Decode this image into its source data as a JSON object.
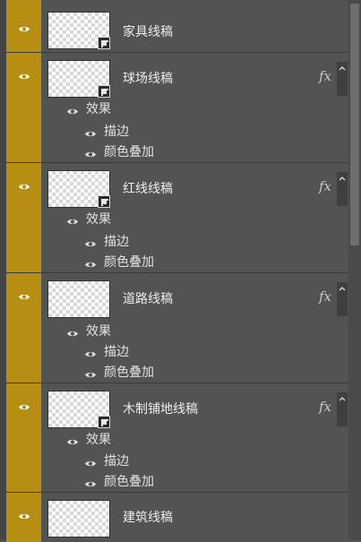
{
  "colors": {
    "visibility_column": "#b58e12",
    "panel_bg": "#535353"
  },
  "layers": [
    {
      "name": "家具线稿",
      "has_fx": false,
      "has_smart_badge": true,
      "effects": null
    },
    {
      "name": "球场线稿",
      "has_fx": true,
      "fx_label": "fx",
      "has_smart_badge": true,
      "effects": {
        "label": "效果",
        "items": [
          "描边",
          "颜色叠加"
        ]
      }
    },
    {
      "name": "红线线稿",
      "has_fx": true,
      "fx_label": "fx",
      "has_smart_badge": true,
      "effects": {
        "label": "效果",
        "items": [
          "描边",
          "颜色叠加"
        ]
      }
    },
    {
      "name": "道路线稿",
      "has_fx": true,
      "fx_label": "fx",
      "has_smart_badge": false,
      "effects": {
        "label": "效果",
        "items": [
          "描边",
          "颜色叠加"
        ]
      }
    },
    {
      "name": "木制铺地线稿",
      "has_fx": true,
      "fx_label": "fx",
      "has_smart_badge": true,
      "effects": {
        "label": "效果",
        "items": [
          "描边",
          "颜色叠加"
        ]
      }
    },
    {
      "name": "建筑线稿",
      "has_fx": false,
      "has_smart_badge": false,
      "effects": null
    }
  ],
  "icons": {
    "eye": "eye-icon",
    "caret": "chevron-up-icon",
    "smart_object": "smart-object-icon"
  }
}
